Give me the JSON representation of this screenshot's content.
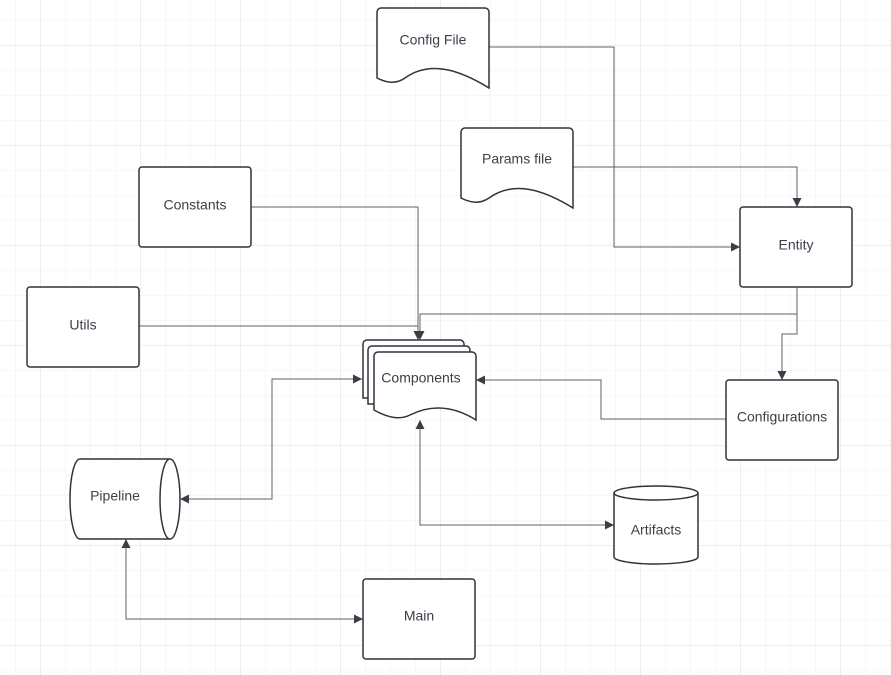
{
  "diagram": {
    "nodes": {
      "config_file": {
        "label": "Config File",
        "shape": "document"
      },
      "params_file": {
        "label": "Params file",
        "shape": "document"
      },
      "constants": {
        "label": "Constants",
        "shape": "rectangle"
      },
      "utils": {
        "label": "Utils",
        "shape": "rectangle"
      },
      "entity": {
        "label": "Entity",
        "shape": "rectangle"
      },
      "components": {
        "label": "Components",
        "shape": "multi-document"
      },
      "configurations": {
        "label": "Configurations",
        "shape": "rectangle"
      },
      "pipeline": {
        "label": "Pipeline",
        "shape": "horizontal-cylinder"
      },
      "artifacts": {
        "label": "Artifacts",
        "shape": "cylinder"
      },
      "main": {
        "label": "Main",
        "shape": "rectangle"
      }
    },
    "edges": [
      {
        "from": "Config File",
        "to": "Entity"
      },
      {
        "from": "Params file",
        "to": "Entity"
      },
      {
        "from": "Constants",
        "to": "Components"
      },
      {
        "from": "Utils",
        "to": "Components"
      },
      {
        "from": "Entity",
        "to": "Components"
      },
      {
        "from": "Entity",
        "to": "Configurations"
      },
      {
        "from": "Configurations",
        "to": "Components"
      },
      {
        "from": "Components",
        "to": "Pipeline",
        "bidirectional": true
      },
      {
        "from": "Components",
        "to": "Artifacts",
        "bidirectional": true
      },
      {
        "from": "Pipeline",
        "to": "Main",
        "bidirectional": true
      }
    ],
    "colors": {
      "stroke": "#2f343b",
      "connector": "#5c6168",
      "text": "#3a414a",
      "grid_minor": "#eeeeee",
      "grid_major": "#dddddd"
    }
  }
}
